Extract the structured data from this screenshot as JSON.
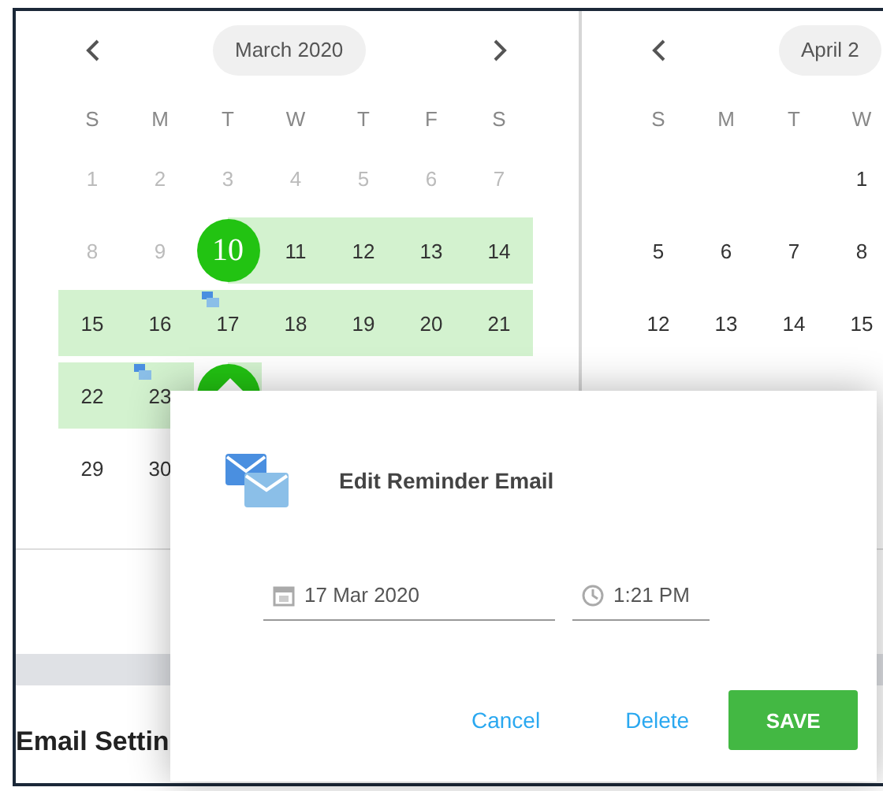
{
  "calendars": [
    {
      "title": "March 2020",
      "has_prev": true,
      "has_next": true,
      "weekdays": [
        "S",
        "M",
        "T",
        "W",
        "T",
        "F",
        "S"
      ],
      "weeks": [
        [
          {
            "day": "1",
            "muted": true
          },
          {
            "day": "2",
            "muted": true
          },
          {
            "day": "3",
            "muted": true
          },
          {
            "day": "4",
            "muted": true
          },
          {
            "day": "5",
            "muted": true
          },
          {
            "day": "6",
            "muted": true
          },
          {
            "day": "7",
            "muted": true
          }
        ],
        [
          {
            "day": "8",
            "muted": true
          },
          {
            "day": "9",
            "muted": true
          },
          {
            "day": "10",
            "selected": true,
            "range": true
          },
          {
            "day": "11",
            "range": true
          },
          {
            "day": "12",
            "range": true
          },
          {
            "day": "13",
            "range": true
          },
          {
            "day": "14",
            "range": true
          }
        ],
        [
          {
            "day": "15",
            "range": true
          },
          {
            "day": "16",
            "range": true
          },
          {
            "day": "17",
            "range": true,
            "reminder": true
          },
          {
            "day": "18",
            "range": true
          },
          {
            "day": "19",
            "range": true
          },
          {
            "day": "20",
            "range": true
          },
          {
            "day": "21",
            "range": true
          }
        ],
        [
          {
            "day": "22",
            "range": true
          },
          {
            "day": "23",
            "range": true,
            "reminder": true
          },
          {
            "selected": true,
            "range": true
          }
        ],
        [
          {
            "day": "29"
          },
          {
            "day": "30"
          }
        ]
      ]
    },
    {
      "title": "April 2",
      "has_prev": true,
      "has_next": false,
      "weekdays": [
        "S",
        "M",
        "T",
        "W"
      ],
      "weeks": [
        [
          {
            "blank": true
          },
          {
            "blank": true
          },
          {
            "blank": true
          },
          {
            "day": "1"
          }
        ],
        [
          {
            "day": "5"
          },
          {
            "day": "6"
          },
          {
            "day": "7"
          },
          {
            "day": "8"
          }
        ],
        [
          {
            "day": "12"
          },
          {
            "day": "13"
          },
          {
            "day": "14"
          },
          {
            "day": "15"
          }
        ]
      ]
    }
  ],
  "section_heading": "Email Settin",
  "dialog": {
    "title": "Edit Reminder Email",
    "date": "17 Mar 2020",
    "time": "1:21 PM",
    "buttons": [
      {
        "label": "Cancel",
        "kind": "text"
      },
      {
        "label": "Delete",
        "kind": "text"
      },
      {
        "label": "SAVE",
        "kind": "primary"
      }
    ]
  }
}
